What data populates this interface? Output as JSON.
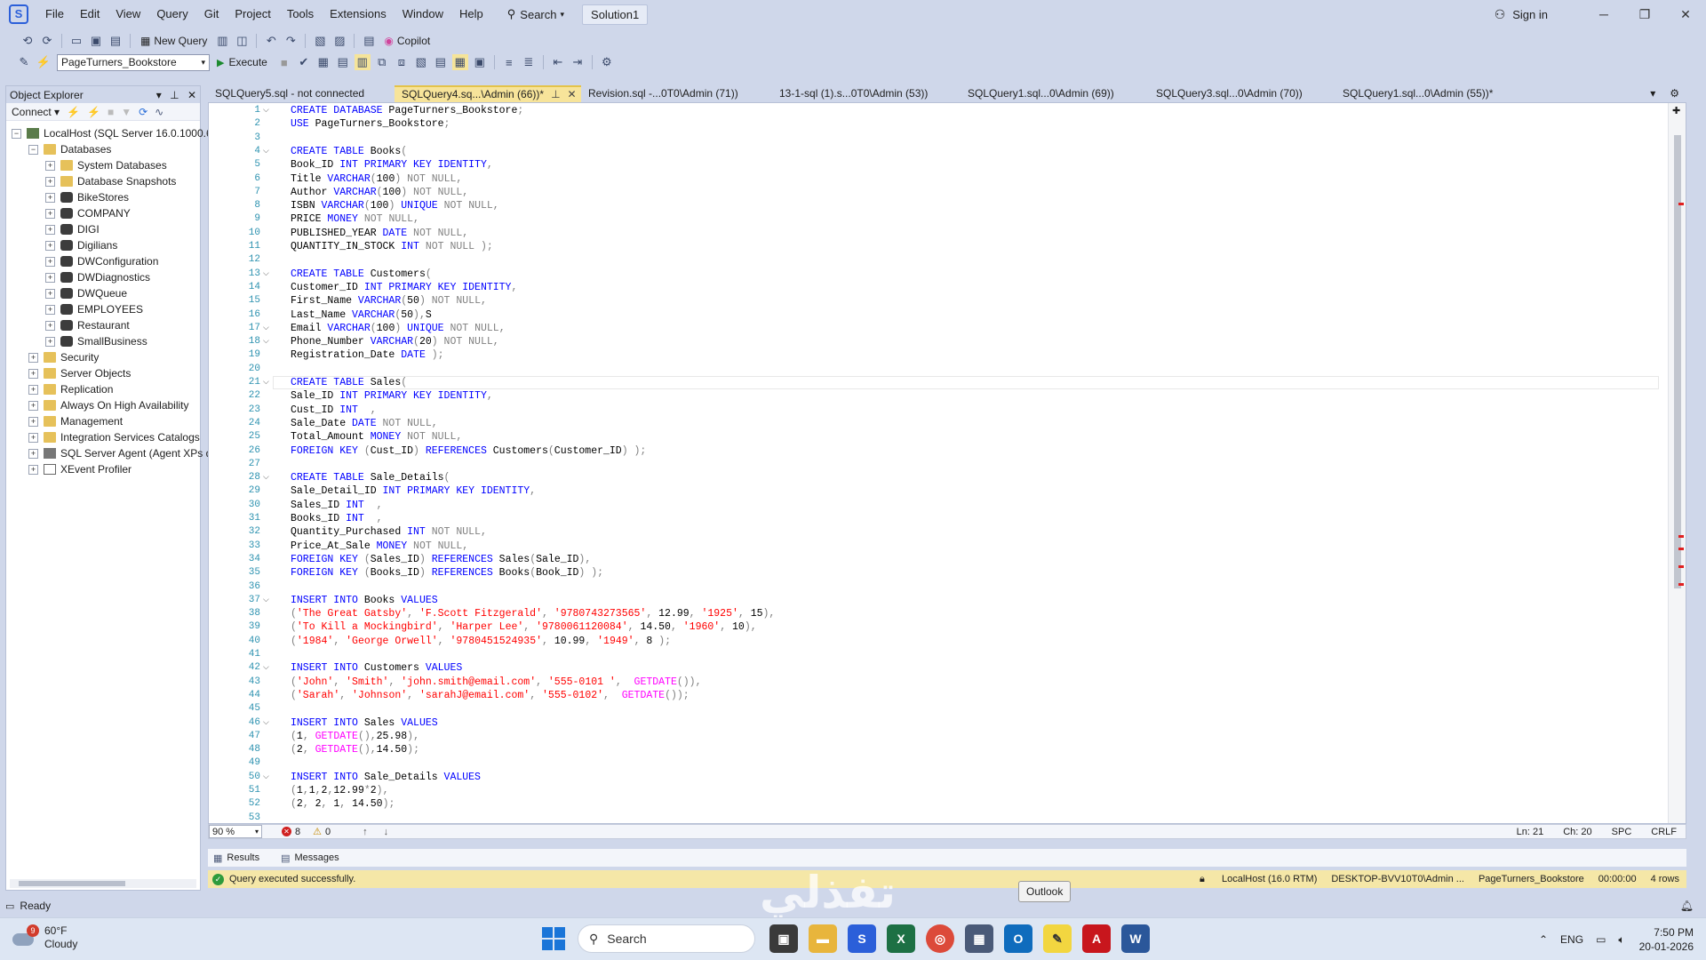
{
  "menu": {
    "items": [
      "File",
      "Edit",
      "View",
      "Query",
      "Git",
      "Project",
      "Tools",
      "Extensions",
      "Window",
      "Help"
    ],
    "search_label": "Search",
    "solution": "Solution1",
    "sign_in": "Sign in"
  },
  "toolbar": {
    "new_query": "New Query",
    "copilot": "Copilot",
    "database": "PageTurners_Bookstore",
    "execute": "Execute"
  },
  "object_explorer": {
    "title": "Object Explorer",
    "connect": "Connect",
    "server": "LocalHost (SQL Server 16.0.1000.6",
    "databases": "Databases",
    "db_items": [
      "System Databases",
      "Database Snapshots",
      "BikeStores",
      "COMPANY",
      "DIGI",
      "Digilians",
      "DWConfiguration",
      "DWDiagnostics",
      "DWQueue",
      "EMPLOYEES",
      "Restaurant",
      "SmallBusiness"
    ],
    "server_items": [
      "Security",
      "Server Objects",
      "Replication",
      "Always On High Availability",
      "Management",
      "Integration Services Catalogs",
      "SQL Server Agent (Agent XPs d",
      "XEvent Profiler"
    ]
  },
  "tabs": [
    {
      "label": "SQLQuery5.sql - not connected"
    },
    {
      "label": "SQLQuery4.sq...\\Admin (66))*",
      "active": true
    },
    {
      "label": "Revision.sql -...0T0\\Admin (71))"
    },
    {
      "label": "13-1-sql (1).s...0T0\\Admin (53))"
    },
    {
      "label": "SQLQuery1.sql...0\\Admin (69))"
    },
    {
      "label": "SQLQuery3.sql...0\\Admin (70))"
    },
    {
      "label": "SQLQuery1.sql...0\\Admin (55))*"
    }
  ],
  "code_lines": [
    [
      [
        "kw",
        "CREATE DATABASE"
      ],
      [
        "t",
        " PageTurners_Bookstore"
      ],
      [
        "gr",
        ";"
      ]
    ],
    [
      [
        "kw",
        "USE"
      ],
      [
        "t",
        " PageTurners_Bookstore"
      ],
      [
        "gr",
        ";"
      ]
    ],
    [],
    [
      [
        "kw",
        "CREATE TABLE"
      ],
      [
        "t",
        " Books"
      ],
      [
        "gr",
        "("
      ]
    ],
    [
      [
        "t",
        "Book_ID "
      ],
      [
        "kw",
        "INT PRIMARY KEY IDENTITY"
      ],
      [
        "gr",
        ","
      ]
    ],
    [
      [
        "t",
        "Title "
      ],
      [
        "kw",
        "VARCHAR"
      ],
      [
        "gr",
        "("
      ],
      [
        "t",
        "100"
      ],
      [
        "gr",
        ") NOT NULL,"
      ]
    ],
    [
      [
        "t",
        "Author "
      ],
      [
        "kw",
        "VARCHAR"
      ],
      [
        "gr",
        "("
      ],
      [
        "t",
        "100"
      ],
      [
        "gr",
        ") NOT NULL,"
      ]
    ],
    [
      [
        "t",
        "ISBN "
      ],
      [
        "kw",
        "VARCHAR"
      ],
      [
        "gr",
        "("
      ],
      [
        "t",
        "100"
      ],
      [
        "gr",
        ") "
      ],
      [
        "kw",
        "UNIQUE"
      ],
      [
        "gr",
        " NOT NULL,"
      ]
    ],
    [
      [
        "t",
        "PRICE "
      ],
      [
        "kw",
        "MONEY"
      ],
      [
        "gr",
        " NOT NULL,"
      ]
    ],
    [
      [
        "t",
        "PUBLISHED_YEAR "
      ],
      [
        "kw",
        "DATE"
      ],
      [
        "gr",
        " NOT NULL,"
      ]
    ],
    [
      [
        "t",
        "QUANTITY_IN_STOCK "
      ],
      [
        "kw",
        "INT"
      ],
      [
        "gr",
        " NOT NULL );"
      ]
    ],
    [],
    [
      [
        "kw",
        "CREATE TABLE"
      ],
      [
        "t",
        " Customers"
      ],
      [
        "gr",
        "("
      ]
    ],
    [
      [
        "t",
        "Customer_ID "
      ],
      [
        "kw",
        "INT PRIMARY KEY IDENTITY"
      ],
      [
        "gr",
        ","
      ]
    ],
    [
      [
        "t",
        "First_Name "
      ],
      [
        "kw",
        "VARCHAR"
      ],
      [
        "gr",
        "("
      ],
      [
        "t",
        "50"
      ],
      [
        "gr",
        ") NOT NULL,"
      ]
    ],
    [
      [
        "t",
        "Last_Name "
      ],
      [
        "kw",
        "VARCHAR"
      ],
      [
        "gr",
        "("
      ],
      [
        "t",
        "50"
      ],
      [
        "gr",
        "),"
      ],
      [
        "t",
        "S"
      ]
    ],
    [
      [
        "t",
        "Email "
      ],
      [
        "kw",
        "VARCHAR"
      ],
      [
        "gr",
        "("
      ],
      [
        "t",
        "100"
      ],
      [
        "gr",
        ") "
      ],
      [
        "kw",
        "UNIQUE"
      ],
      [
        "gr",
        " NOT NULL,"
      ]
    ],
    [
      [
        "t",
        "Phone_Number "
      ],
      [
        "kw",
        "VARCHAR"
      ],
      [
        "gr",
        "("
      ],
      [
        "t",
        "20"
      ],
      [
        "gr",
        ") NOT NULL,"
      ]
    ],
    [
      [
        "t",
        "Registration_Date "
      ],
      [
        "kw",
        "DATE"
      ],
      [
        "gr",
        " );"
      ]
    ],
    [],
    [
      [
        "kw",
        "CREATE TABLE"
      ],
      [
        "t",
        " Sales"
      ],
      [
        "gr",
        "("
      ]
    ],
    [
      [
        "t",
        "Sale_ID "
      ],
      [
        "kw",
        "INT PRIMARY KEY IDENTITY"
      ],
      [
        "gr",
        ","
      ]
    ],
    [
      [
        "t",
        "Cust_ID "
      ],
      [
        "kw",
        "INT"
      ],
      [
        "gr",
        "  ,"
      ]
    ],
    [
      [
        "t",
        "Sale_Date "
      ],
      [
        "kw",
        "DATE"
      ],
      [
        "gr",
        " NOT NULL,"
      ]
    ],
    [
      [
        "t",
        "Total_Amount "
      ],
      [
        "kw",
        "MONEY"
      ],
      [
        "gr",
        " NOT NULL,"
      ]
    ],
    [
      [
        "kw",
        "FOREIGN KEY"
      ],
      [
        "gr",
        " ("
      ],
      [
        "t",
        "Cust_ID"
      ],
      [
        "gr",
        ") "
      ],
      [
        "kw",
        "REFERENCES"
      ],
      [
        "t",
        " Customers"
      ],
      [
        "gr",
        "("
      ],
      [
        "t",
        "Customer_ID"
      ],
      [
        "gr",
        ") );"
      ]
    ],
    [],
    [
      [
        "kw",
        "CREATE TABLE"
      ],
      [
        "t",
        " Sale_Details"
      ],
      [
        "gr",
        "("
      ]
    ],
    [
      [
        "t",
        "Sale_Detail_ID "
      ],
      [
        "kw",
        "INT PRIMARY KEY IDENTITY"
      ],
      [
        "gr",
        ","
      ]
    ],
    [
      [
        "t",
        "Sales_ID "
      ],
      [
        "kw",
        "INT"
      ],
      [
        "gr",
        "  ,"
      ]
    ],
    [
      [
        "t",
        "Books_ID "
      ],
      [
        "kw",
        "INT"
      ],
      [
        "gr",
        "  ,"
      ]
    ],
    [
      [
        "t",
        "Quantity_Purchased "
      ],
      [
        "kw",
        "INT"
      ],
      [
        "gr",
        " NOT NULL,"
      ]
    ],
    [
      [
        "t",
        "Price_At_Sale "
      ],
      [
        "kw",
        "MONEY"
      ],
      [
        "gr",
        " NOT NULL,"
      ]
    ],
    [
      [
        "kw",
        "FOREIGN KEY"
      ],
      [
        "gr",
        " ("
      ],
      [
        "t",
        "Sales_ID"
      ],
      [
        "gr",
        ") "
      ],
      [
        "kw",
        "REFERENCES"
      ],
      [
        "t",
        " Sales"
      ],
      [
        "gr",
        "("
      ],
      [
        "t",
        "Sale_ID"
      ],
      [
        "gr",
        "),"
      ]
    ],
    [
      [
        "kw",
        "FOREIGN KEY"
      ],
      [
        "gr",
        " ("
      ],
      [
        "t",
        "Books_ID"
      ],
      [
        "gr",
        ") "
      ],
      [
        "kw",
        "REFERENCES"
      ],
      [
        "t",
        " Books"
      ],
      [
        "gr",
        "("
      ],
      [
        "t",
        "Book_ID"
      ],
      [
        "gr",
        ") );"
      ]
    ],
    [],
    [
      [
        "kw",
        "INSERT INTO"
      ],
      [
        "t",
        " Books "
      ],
      [
        "kw",
        "VALUES"
      ]
    ],
    [
      [
        "gr",
        "("
      ],
      [
        "st",
        "'The Great Gatsby'"
      ],
      [
        "gr",
        ", "
      ],
      [
        "st",
        "'F.Scott Fitzgerald'"
      ],
      [
        "gr",
        ", "
      ],
      [
        "st",
        "'9780743273565'"
      ],
      [
        "gr",
        ", "
      ],
      [
        "t",
        "12.99"
      ],
      [
        "gr",
        ", "
      ],
      [
        "st",
        "'1925'"
      ],
      [
        "gr",
        ", "
      ],
      [
        "t",
        "15"
      ],
      [
        "gr",
        "),"
      ]
    ],
    [
      [
        "gr",
        "("
      ],
      [
        "st",
        "'To Kill a Mockingbird'"
      ],
      [
        "gr",
        ", "
      ],
      [
        "st",
        "'Harper Lee'"
      ],
      [
        "gr",
        ", "
      ],
      [
        "st",
        "'9780061120084'"
      ],
      [
        "gr",
        ", "
      ],
      [
        "t",
        "14.50"
      ],
      [
        "gr",
        ", "
      ],
      [
        "st",
        "'1960'"
      ],
      [
        "gr",
        ", "
      ],
      [
        "t",
        "10"
      ],
      [
        "gr",
        "),"
      ]
    ],
    [
      [
        "gr",
        "("
      ],
      [
        "st",
        "'1984'"
      ],
      [
        "gr",
        ", "
      ],
      [
        "st",
        "'George Orwell'"
      ],
      [
        "gr",
        ", "
      ],
      [
        "st",
        "'9780451524935'"
      ],
      [
        "gr",
        ", "
      ],
      [
        "t",
        "10.99"
      ],
      [
        "gr",
        ", "
      ],
      [
        "st",
        "'1949'"
      ],
      [
        "gr",
        ", "
      ],
      [
        "t",
        "8"
      ],
      [
        "gr",
        " );"
      ]
    ],
    [],
    [
      [
        "kw",
        "INSERT INTO"
      ],
      [
        "t",
        " Customers "
      ],
      [
        "kw",
        "VALUES"
      ]
    ],
    [
      [
        "gr",
        "("
      ],
      [
        "st",
        "'John'"
      ],
      [
        "gr",
        ", "
      ],
      [
        "st",
        "'Smith'"
      ],
      [
        "gr",
        ", "
      ],
      [
        "st",
        "'john.smith@email.com'"
      ],
      [
        "gr",
        ", "
      ],
      [
        "st",
        "'555-0101 '"
      ],
      [
        "gr",
        ",  "
      ],
      [
        "fn",
        "GETDATE"
      ],
      [
        "gr",
        "()),"
      ]
    ],
    [
      [
        "gr",
        "("
      ],
      [
        "st",
        "'Sarah'"
      ],
      [
        "gr",
        ", "
      ],
      [
        "st",
        "'Johnson'"
      ],
      [
        "gr",
        ", "
      ],
      [
        "st",
        "'sarahJ@email.com'"
      ],
      [
        "gr",
        ", "
      ],
      [
        "st",
        "'555-0102'"
      ],
      [
        "gr",
        ",  "
      ],
      [
        "fn",
        "GETDATE"
      ],
      [
        "gr",
        "());"
      ]
    ],
    [],
    [
      [
        "kw",
        "INSERT INTO"
      ],
      [
        "t",
        " Sales "
      ],
      [
        "kw",
        "VALUES"
      ]
    ],
    [
      [
        "gr",
        "("
      ],
      [
        "t",
        "1"
      ],
      [
        "gr",
        ", "
      ],
      [
        "fn",
        "GETDATE"
      ],
      [
        "gr",
        "(),"
      ],
      [
        "t",
        "25.98"
      ],
      [
        "gr",
        "),"
      ]
    ],
    [
      [
        "gr",
        "("
      ],
      [
        "t",
        "2"
      ],
      [
        "gr",
        ", "
      ],
      [
        "fn",
        "GETDATE"
      ],
      [
        "gr",
        "(),"
      ],
      [
        "t",
        "14.50"
      ],
      [
        "gr",
        ");"
      ]
    ],
    [],
    [
      [
        "kw",
        "INSERT INTO"
      ],
      [
        "t",
        " Sale_Details "
      ],
      [
        "kw",
        "VALUES"
      ]
    ],
    [
      [
        "gr",
        "("
      ],
      [
        "t",
        "1"
      ],
      [
        "gr",
        ","
      ],
      [
        "t",
        "1"
      ],
      [
        "gr",
        ","
      ],
      [
        "t",
        "2"
      ],
      [
        "gr",
        ","
      ],
      [
        "t",
        "12.99"
      ],
      [
        "gr",
        "*"
      ],
      [
        "t",
        "2"
      ],
      [
        "gr",
        "),"
      ]
    ],
    [
      [
        "gr",
        "("
      ],
      [
        "t",
        "2"
      ],
      [
        "gr",
        ", "
      ],
      [
        "t",
        "2"
      ],
      [
        "gr",
        ", "
      ],
      [
        "t",
        "1"
      ],
      [
        "gr",
        ", "
      ],
      [
        "t",
        "14.50"
      ],
      [
        "gr",
        ");"
      ]
    ],
    []
  ],
  "editor_status": {
    "zoom": "90 %",
    "errors": "8",
    "warnings": "0",
    "line": "Ln: 21",
    "col": "Ch: 20",
    "spc": "SPC",
    "crlf": "CRLF"
  },
  "results": {
    "results_tab": "Results",
    "messages_tab": "Messages"
  },
  "query_status": {
    "message": "Query executed successfully.",
    "server": "LocalHost (16.0 RTM)",
    "user": "DESKTOP-BVV10T0\\Admin ...",
    "database": "PageTurners_Bookstore",
    "time": "00:00:00",
    "rows": "4 rows"
  },
  "status_bar": {
    "ready": "Ready"
  },
  "tooltip": "Outlook",
  "taskbar": {
    "weather_temp": "60°F",
    "weather_desc": "Cloudy",
    "weather_badge": "9",
    "search": "Search",
    "lang": "ENG",
    "time": "7:50 PM",
    "date": "20-01-2026"
  },
  "colors": {
    "keyword": "#0000ff",
    "string": "#ff0000",
    "function": "#ff00ff",
    "gray": "#808080",
    "line_number": "#2b91af"
  }
}
